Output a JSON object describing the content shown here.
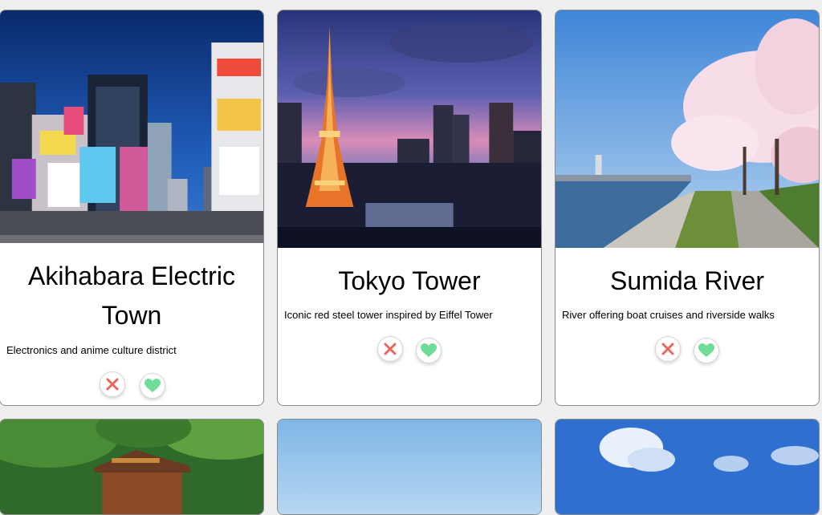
{
  "cards": [
    {
      "title": "Akihabara Electric Town",
      "description": "Electronics and anime culture district",
      "image_desc": "Akihabara street with neon signs"
    },
    {
      "title": "Tokyo Tower",
      "description": "Iconic red steel tower inspired by Eiffel Tower",
      "image_desc": "Tokyo Tower illuminated at dusk"
    },
    {
      "title": "Sumida River",
      "description": "River offering boat cruises and riverside walks",
      "image_desc": "Sumida River with cherry blossoms"
    }
  ],
  "actions": {
    "dislike_icon": "close-icon",
    "like_icon": "heart-icon"
  },
  "colors": {
    "dislike": "#e8675a",
    "like": "#6fdc9a",
    "card_border": "#8a8a8a",
    "page_bg": "#efefef"
  }
}
